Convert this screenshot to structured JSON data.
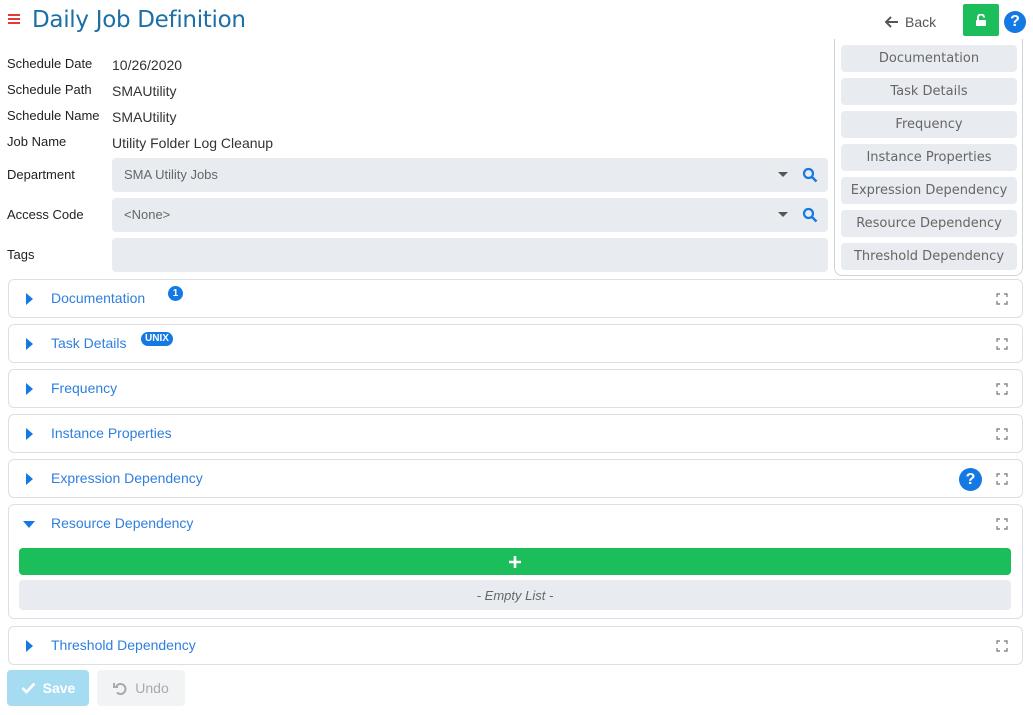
{
  "header": {
    "title": "Daily Job Definition",
    "back_label": "Back",
    "menu_icon": "hamburger-menu-icon",
    "lock_icon": "unlock-icon",
    "help_icon": "question-circle-icon"
  },
  "info": {
    "schedule_date_label": "Schedule Date",
    "schedule_date": "10/26/2020",
    "schedule_path_label": "Schedule Path",
    "schedule_path": "SMAUtility",
    "schedule_name_label": "Schedule Name",
    "schedule_name": "SMAUtility",
    "job_name_label": "Job Name",
    "job_name": "Utility Folder Log Cleanup"
  },
  "fields": {
    "department_label": "Department",
    "department_value": "SMA Utility Jobs",
    "access_code_label": "Access Code",
    "access_code_value": "<None>",
    "tags_label": "Tags",
    "tags_value": ""
  },
  "quick_nav": [
    "Documentation",
    "Task Details",
    "Frequency",
    "Instance Properties",
    "Expression Dependency",
    "Resource Dependency",
    "Threshold Dependency"
  ],
  "panels": [
    {
      "title": "Documentation",
      "badge": "1",
      "expanded": false
    },
    {
      "title": "Task Details",
      "badge": "UNIX",
      "expanded": false
    },
    {
      "title": "Frequency",
      "expanded": false
    },
    {
      "title": "Instance Properties",
      "expanded": false
    },
    {
      "title": "Expression Dependency",
      "expanded": false,
      "help": true
    },
    {
      "title": "Resource Dependency",
      "expanded": true,
      "add_label": "+",
      "empty_label": "- Empty List -"
    },
    {
      "title": "Threshold Dependency",
      "expanded": false
    }
  ],
  "footer": {
    "save_label": "Save",
    "undo_label": "Undo"
  },
  "colors": {
    "accent_blue": "#1479e3",
    "title_blue": "#1d6fa5",
    "success_green": "#1cbe5b",
    "menu_red": "#e53935",
    "field_gray": "#e8ebf0"
  }
}
